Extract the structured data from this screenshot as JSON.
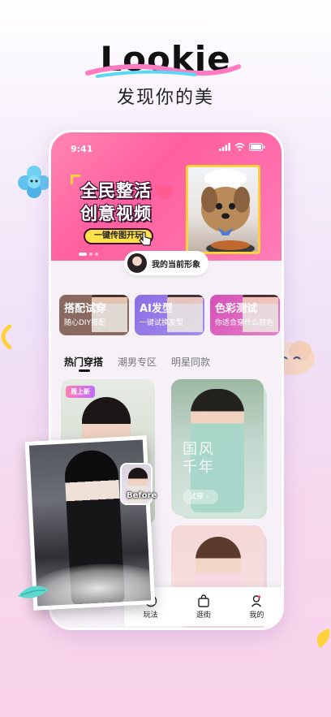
{
  "header": {
    "app_name": "Lookie",
    "tagline": "发现你的美"
  },
  "status_bar": {
    "time": "9:41"
  },
  "banner": {
    "title_line1": "全民整活",
    "title_line2": "创意视频",
    "cta": "一键传图开玩"
  },
  "current_look": {
    "label": "我的当前形象"
  },
  "features": [
    {
      "title": "搭配试穿",
      "subtitle": "随心DIY搭配",
      "color": "#8a6a60"
    },
    {
      "title": "AI发型",
      "subtitle": "一键试换发型",
      "color": "#9478e6"
    },
    {
      "title": "色彩测试",
      "subtitle": "你适合穿什么颜色",
      "color": "#d94fb6"
    }
  ],
  "tabs": [
    {
      "label": "热门穿搭",
      "active": true
    },
    {
      "label": "潮男专区",
      "active": false
    },
    {
      "label": "明星同款",
      "active": false
    }
  ],
  "cards": {
    "new_badge": "周上新",
    "guofeng_title": "国风\n千年",
    "try_button": "试穿 ›"
  },
  "overlay": {
    "before_label": "Before"
  },
  "tabbar": {
    "items": [
      {
        "label": "玩法",
        "icon": "play-icon"
      },
      {
        "label": "逛街",
        "icon": "shopping-bag-icon"
      },
      {
        "label": "我的",
        "icon": "profile-icon"
      }
    ]
  },
  "colors": {
    "accent_pink": "#ff5f9e",
    "highlight_yellow": "#ffd23c",
    "ai_purple": "#9478e6",
    "color_test_magenta": "#d94fb6"
  }
}
